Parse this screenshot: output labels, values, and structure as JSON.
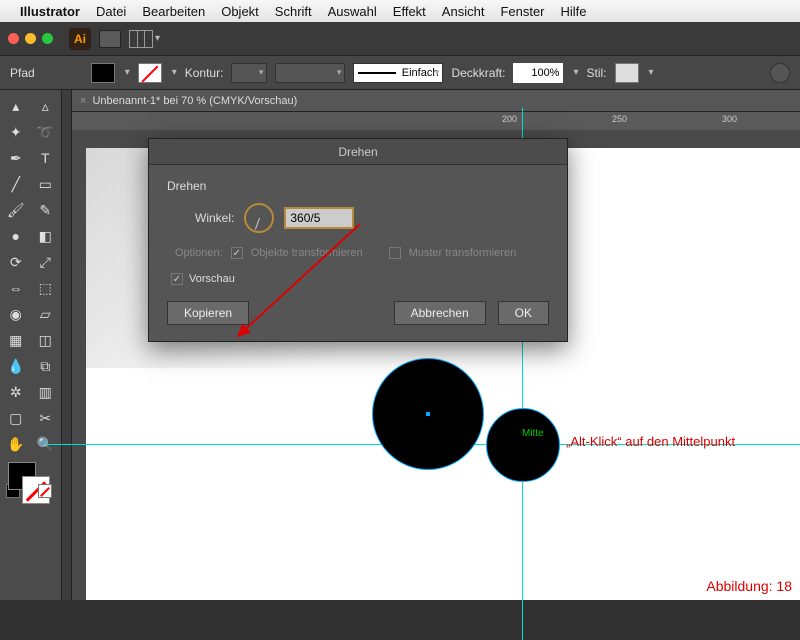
{
  "mac_menu": {
    "app": "Illustrator",
    "items": [
      "Datei",
      "Bearbeiten",
      "Objekt",
      "Schrift",
      "Auswahl",
      "Effekt",
      "Ansicht",
      "Fenster",
      "Hilfe"
    ]
  },
  "control_bar": {
    "path_label": "Pfad",
    "stroke_label": "Kontur:",
    "stroke_style": "Einfach",
    "opacity_label": "Deckkraft:",
    "opacity_value": "100%",
    "style_label": "Stil:"
  },
  "document": {
    "tab_title": "Unbenannt-1* bei 70 % (CMYK/Vorschau)",
    "ruler_marks": [
      "200",
      "250",
      "300"
    ]
  },
  "dialog": {
    "title": "Drehen",
    "section": "Drehen",
    "angle_label": "Winkel:",
    "angle_value": "360/5",
    "options_label": "Optionen:",
    "opt_transform_objects": "Objekte transformieren",
    "opt_transform_patterns": "Muster transformieren",
    "preview_label": "Vorschau",
    "btn_copy": "Kopieren",
    "btn_cancel": "Abbrechen",
    "btn_ok": "OK"
  },
  "annotations": {
    "mitte": "Mitte",
    "alt_click": "„Alt-Klick“ auf den Mittelpunkt",
    "figure": "Abbildung: 18"
  },
  "colors": {
    "accent": "#b78a3a",
    "guide": "#00e0d0",
    "anno_red": "#d00000"
  }
}
